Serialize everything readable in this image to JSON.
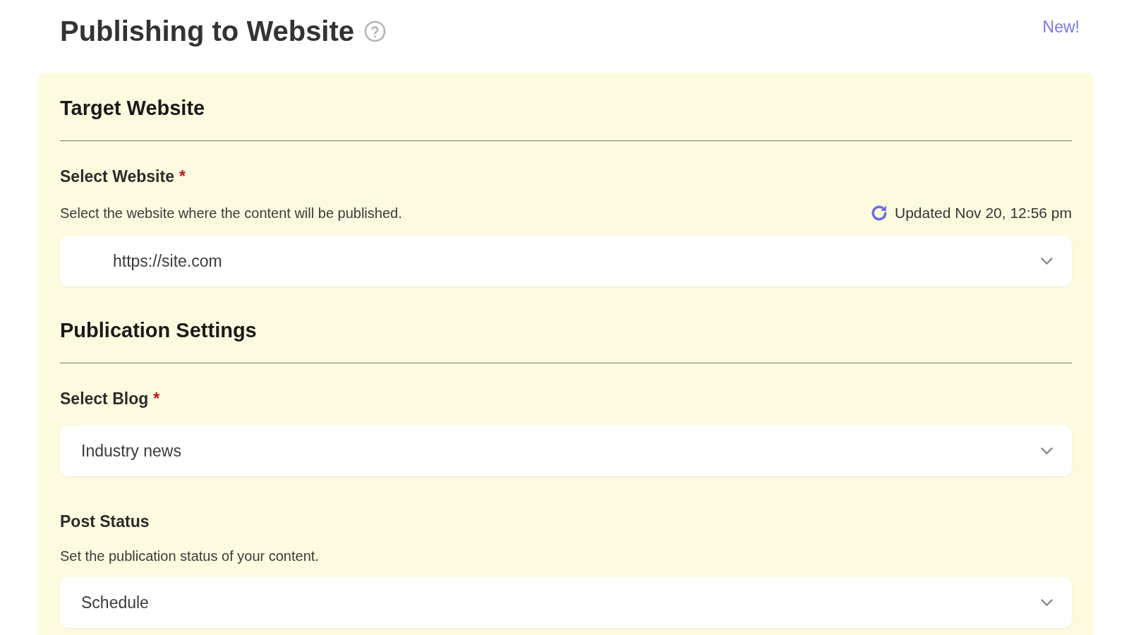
{
  "header": {
    "title": "Publishing to Website",
    "badge": "New!"
  },
  "sections": [
    {
      "heading": "Target Website",
      "fields": [
        {
          "kind": "website",
          "label": "Select Website",
          "required_mark": "*",
          "description": "Select the website where the content will be published.",
          "updated": "Updated Nov 20, 12:56 pm",
          "value": "https://site.com"
        }
      ]
    },
    {
      "heading": "Publication Settings",
      "fields": [
        {
          "kind": "plain",
          "label": "Select Blog",
          "required_mark": "*",
          "value": "Industry news"
        },
        {
          "kind": "plain",
          "label": "Post Status",
          "description": "Set the publication status of your content.",
          "value": "Schedule"
        }
      ]
    }
  ]
}
